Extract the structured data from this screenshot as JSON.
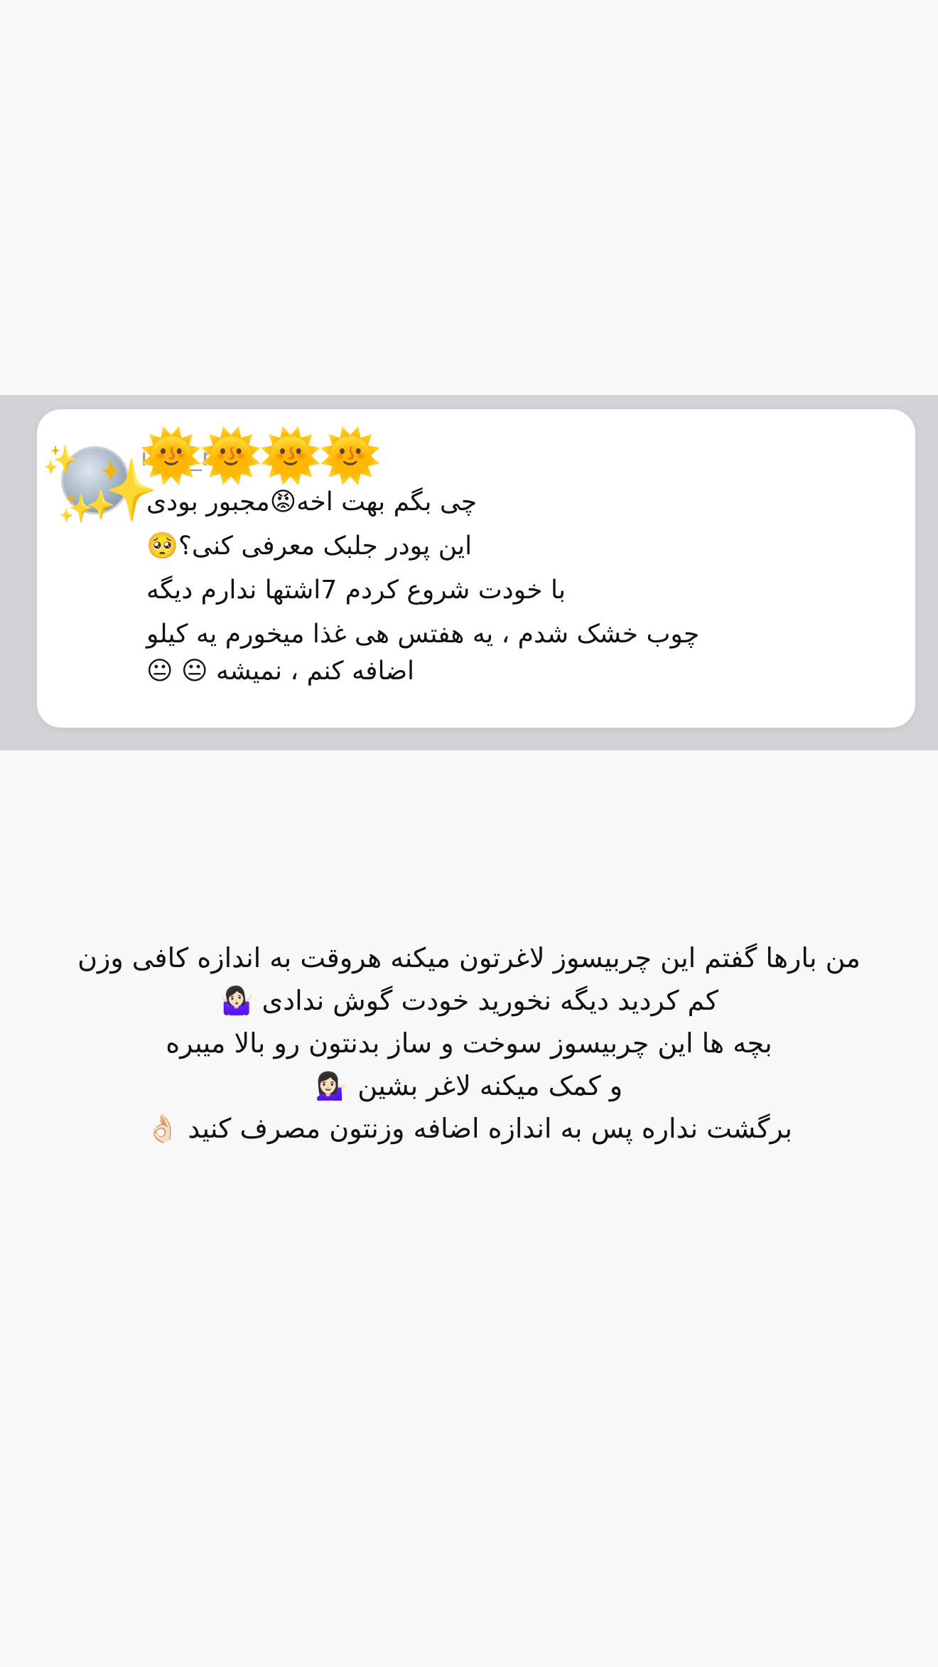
{
  "comment": {
    "username": "ia_d_n",
    "sun_emojis": [
      "🌞",
      "🌞",
      "🌞",
      "🌞"
    ],
    "lines": [
      "چی بگم بهت اخه😡مجبور بودی",
      "این پودر جلبک معرفی کنی؟🥺",
      "با خودت شروع کردم 7اشتها ندارم دیگه",
      "چوب خشک شدم ، یه هفتس هی غذا میخورم یه کیلو",
      "اضافه کنم ، نمیشه 😐 😐"
    ],
    "avatar_sparkles": [
      "✨",
      "✨",
      "✨"
    ]
  },
  "caption": {
    "lines": [
      "من بارها گفتم این چربیسوز لاغرتون میکنه هروقت به اندازه کافی وزن",
      "کم کردید دیگه نخورید خودت گوش ندادی 🤷🏻‍♀️",
      "بچه ها این چربیسوز سوخت و ساز بدنتون رو بالا میبره",
      "و کمک میکنه لاغر بشین 💁🏻‍♀️",
      "برگشت نداره پس به اندازه اضافه وزنتون مصرف کنید 👌🏻"
    ]
  },
  "colors": {
    "page_background": "#f8f8f9",
    "band_background": "#d2d2d6",
    "card_background": "#ffffff",
    "text": "#111111"
  }
}
